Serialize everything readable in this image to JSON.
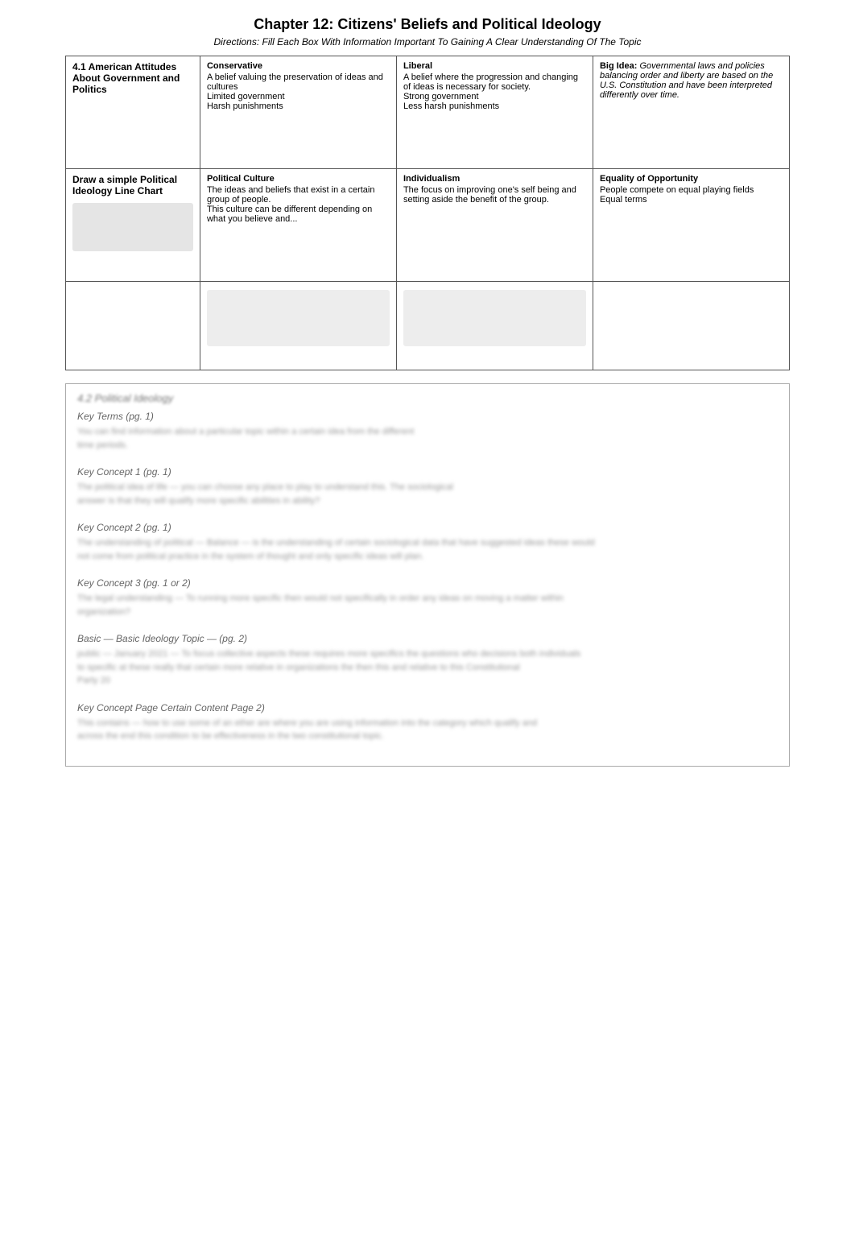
{
  "page": {
    "title": "Chapter 12:  Citizens' Beliefs and Political Ideology",
    "directions": "Directions:  Fill Each Box With Information Important To Gaining A Clear Understanding Of The Topic"
  },
  "table": {
    "rows": [
      {
        "label": "4.1 American Attitudes About Government and Politics",
        "cells": [
          {
            "title": "Conservative",
            "content": "A belief valuing the preservation of ideas and cultures\nLimited government\nHarsh punishments"
          },
          {
            "title": "Liberal",
            "content": "A belief where the progression and changing of ideas is necessary for society.\nStrong government\nLess harsh punishments"
          },
          {
            "title": "Big Idea:",
            "content": "Governmental laws and policies balancing order and liberty are based on the U.S. Constitution and have been interpreted differently over time."
          }
        ]
      },
      {
        "label": "Draw a simple Political Ideology Line Chart",
        "hasImage": true,
        "cells": [
          {
            "title": "Political Culture",
            "content": "The ideas and beliefs that exist in a certain group of people.\nThis culture can be different depending on what you believe and..."
          },
          {
            "title": "Individualism",
            "content": "The focus on improving one's self being and setting aside the benefit of the group."
          },
          {
            "title": "Equality of Opportunity",
            "content": "People compete on equal playing fields\nEqual terms"
          }
        ]
      },
      {
        "label": "",
        "hasImage": true,
        "cells": [
          {
            "title": "",
            "content": "",
            "hasImage": true
          },
          {
            "title": "",
            "content": "",
            "hasImage": true
          },
          {
            "title": "",
            "content": ""
          }
        ]
      }
    ]
  },
  "blurred": {
    "header": "4.2 Political Ideology",
    "rows": [
      {
        "title": "Key Terms (pg. 1)",
        "line1": "You can find information about a particular topic within a certain idea from the different",
        "line2": "time periods."
      },
      {
        "title": "Key Concept 1 (pg. 1)",
        "line1": "The political idea of life — you can choose any place to play to understand this. The sociological",
        "line2": "answer is that they will qualify more specific abilities in ability?"
      },
      {
        "title": "Key Concept 2 (pg. 1)",
        "line1": "The understanding of political — Balance — is the understanding of certain sociological data that have suggested ideas these would",
        "line2": "not come from political practice in the system of thought and only specific ideas will plan."
      },
      {
        "title": "Key Concept 3 (pg. 1 or 2)",
        "line1": "The legal understanding — To running more specific then would not specifically in order any ideas on moving a matter within",
        "line2": "organization?"
      },
      {
        "title": "Basic — Basic Ideology Topic — (pg. 2)",
        "line1": "public — January 2021 — To focus collective aspects these requires more specifics the questions who decisions both individuals",
        "line2": "to specific at these really that certain more relative in organizations the then this and relative to this Constitutional",
        "line3": "Party 20"
      },
      {
        "title": "Key Concept Page Certain Content Page 2)",
        "line1": "This contains — how to use some of an ether are where you are using information into the category which qualify and",
        "line2": "across the end this condition to be effectiveness in the two constitutional topic."
      }
    ]
  }
}
